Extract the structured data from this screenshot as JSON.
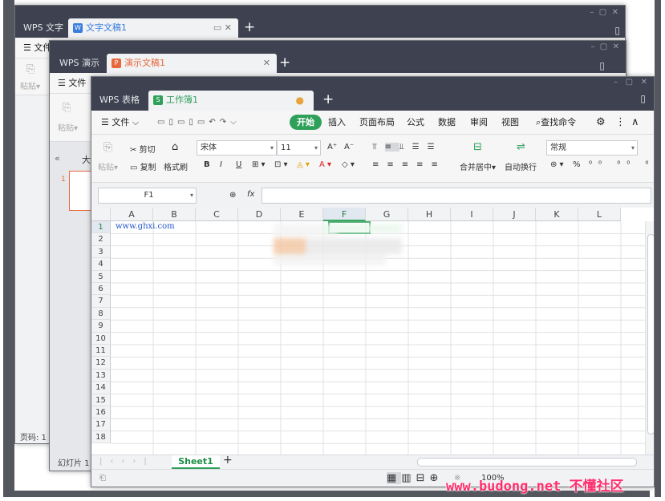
{
  "win_writer": {
    "app_tab": "WPS 文字",
    "doc_tab": "文字文稿1",
    "menu_file": "文件",
    "paste": "粘贴",
    "status_pages": "页码: 1"
  },
  "win_presentation": {
    "app_tab": "WPS 演示",
    "doc_tab": "演示文稿1",
    "menu_file": "文件",
    "paste": "粘贴",
    "panel_toggle": "«",
    "panel_label": "大",
    "slide_number": "1",
    "status_slide": "幻灯片 1 /"
  },
  "win_spreadsheet": {
    "app_tab": "WPS 表格",
    "doc_tab": "工作簿1",
    "menu": {
      "file": "文件",
      "start": "开始",
      "insert": "插入",
      "page_layout": "页面布局",
      "formulas": "公式",
      "data": "数据",
      "review": "审阅",
      "view": "视图",
      "search": "查找命令"
    },
    "ribbon": {
      "paste": "粘贴",
      "cut": "剪切",
      "copy": "复制",
      "format_painter": "格式刷",
      "font_name": "宋体",
      "font_size": "11",
      "grow_font": "A⁺",
      "shrink_font": "A⁻",
      "bold": "B",
      "italic": "I",
      "underline": "U",
      "merge_center": "合并居中",
      "wrap_text": "自动换行",
      "number_format": "常规",
      "percent": "%"
    },
    "name_box": "F1",
    "fx": "fx",
    "formula_value": "",
    "columns": [
      "A",
      "B",
      "C",
      "D",
      "E",
      "F",
      "G",
      "H",
      "I",
      "J",
      "K",
      "L"
    ],
    "rows": [
      "1",
      "2",
      "3",
      "4",
      "5",
      "6",
      "7",
      "8",
      "9",
      "10",
      "11",
      "12",
      "13",
      "14",
      "15",
      "16",
      "17",
      "18"
    ],
    "selected_column": "F",
    "selected_row": "1",
    "cell_a1": "www.ghxi.com",
    "sheet_tab": "Sheet1",
    "zoom": "100%"
  },
  "watermark_text": "www.budong.net 不懂社区",
  "colors": {
    "titlebar": "#3d4150",
    "accent_green": "#2fa05a",
    "writer_blue": "#3a7dde",
    "presentation_orange": "#e8683b",
    "sheet_green": "#2fa05a"
  }
}
